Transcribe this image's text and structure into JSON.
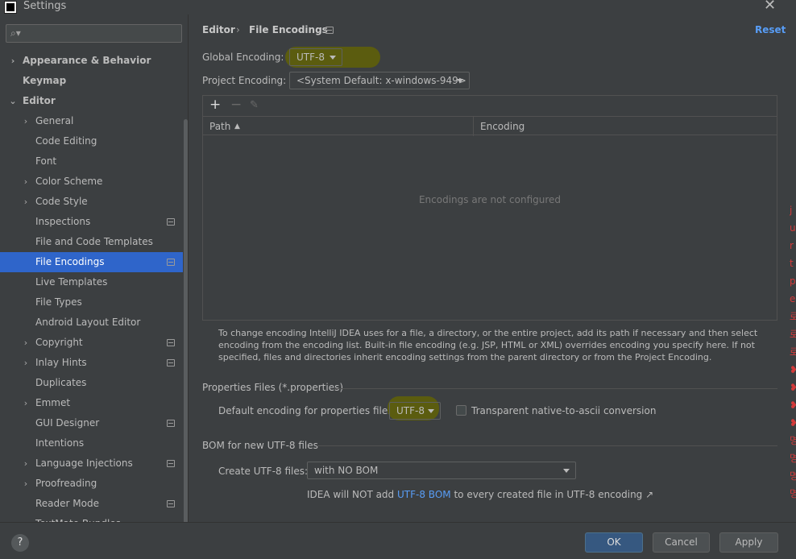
{
  "window": {
    "title": "Settings"
  },
  "sidebar": {
    "search_placeholder": "",
    "items": [
      {
        "label": "Appearance & Behavior",
        "chevron": "›"
      },
      {
        "label": "Keymap"
      },
      {
        "label": "Editor",
        "chevron": "⌄"
      },
      {
        "label": "General",
        "chevron": "›"
      },
      {
        "label": "Code Editing"
      },
      {
        "label": "Font"
      },
      {
        "label": "Color Scheme",
        "chevron": "›"
      },
      {
        "label": "Code Style",
        "chevron": "›"
      },
      {
        "label": "Inspections"
      },
      {
        "label": "File and Code Templates"
      },
      {
        "label": "File Encodings"
      },
      {
        "label": "Live Templates"
      },
      {
        "label": "File Types"
      },
      {
        "label": "Android Layout Editor"
      },
      {
        "label": "Copyright",
        "chevron": "›"
      },
      {
        "label": "Inlay Hints",
        "chevron": "›"
      },
      {
        "label": "Duplicates"
      },
      {
        "label": "Emmet",
        "chevron": "›"
      },
      {
        "label": "GUI Designer"
      },
      {
        "label": "Intentions"
      },
      {
        "label": "Language Injections",
        "chevron": "›"
      },
      {
        "label": "Proofreading",
        "chevron": "›"
      },
      {
        "label": "Reader Mode"
      },
      {
        "label": "TextMate Bundles"
      }
    ]
  },
  "breadcrumb": {
    "parent": "Editor",
    "sep": "›",
    "current": "File Encodings"
  },
  "reset_label": "Reset",
  "global_encoding": {
    "label": "Global Encoding:",
    "value": "UTF-8"
  },
  "project_encoding": {
    "label": "Project Encoding:",
    "value": "<System Default: x-windows-949>"
  },
  "table": {
    "add": "+",
    "remove": "−",
    "edit": "✎",
    "col_path": "Path",
    "sort_indicator": "▲",
    "col_encoding": "Encoding",
    "empty_text": "Encodings are not configured"
  },
  "description": "To change encoding IntelliJ IDEA uses for a file, a directory, or the entire project, add its path if necessary and then select encoding from the encoding list. Built-in file encoding (e.g. JSP, HTML or XML) overrides encoding you specify here. If not specified, files and directories inherit encoding settings from the parent directory or from the Project Encoding.",
  "properties": {
    "section_title": "Properties Files (*.properties)",
    "label": "Default encoding for properties files:",
    "value": "UTF-8",
    "transparent_label": "Transparent native-to-ascii conversion"
  },
  "bom": {
    "section_title": "BOM for new UTF-8 files",
    "label": "Create UTF-8 files:",
    "value": "with NO BOM",
    "note_prefix": "IDEA will NOT add",
    "note_link": "UTF-8 BOM",
    "note_suffix": "to every created file in UTF-8 encoding",
    "note_arrow": "↗"
  },
  "buttons": {
    "help": "?",
    "ok": "OK",
    "cancel": "Cancel",
    "apply": "Apply"
  },
  "colors": {
    "selection": "#2f65ca",
    "link": "#589df6",
    "highlight": "#5b5c0f"
  }
}
